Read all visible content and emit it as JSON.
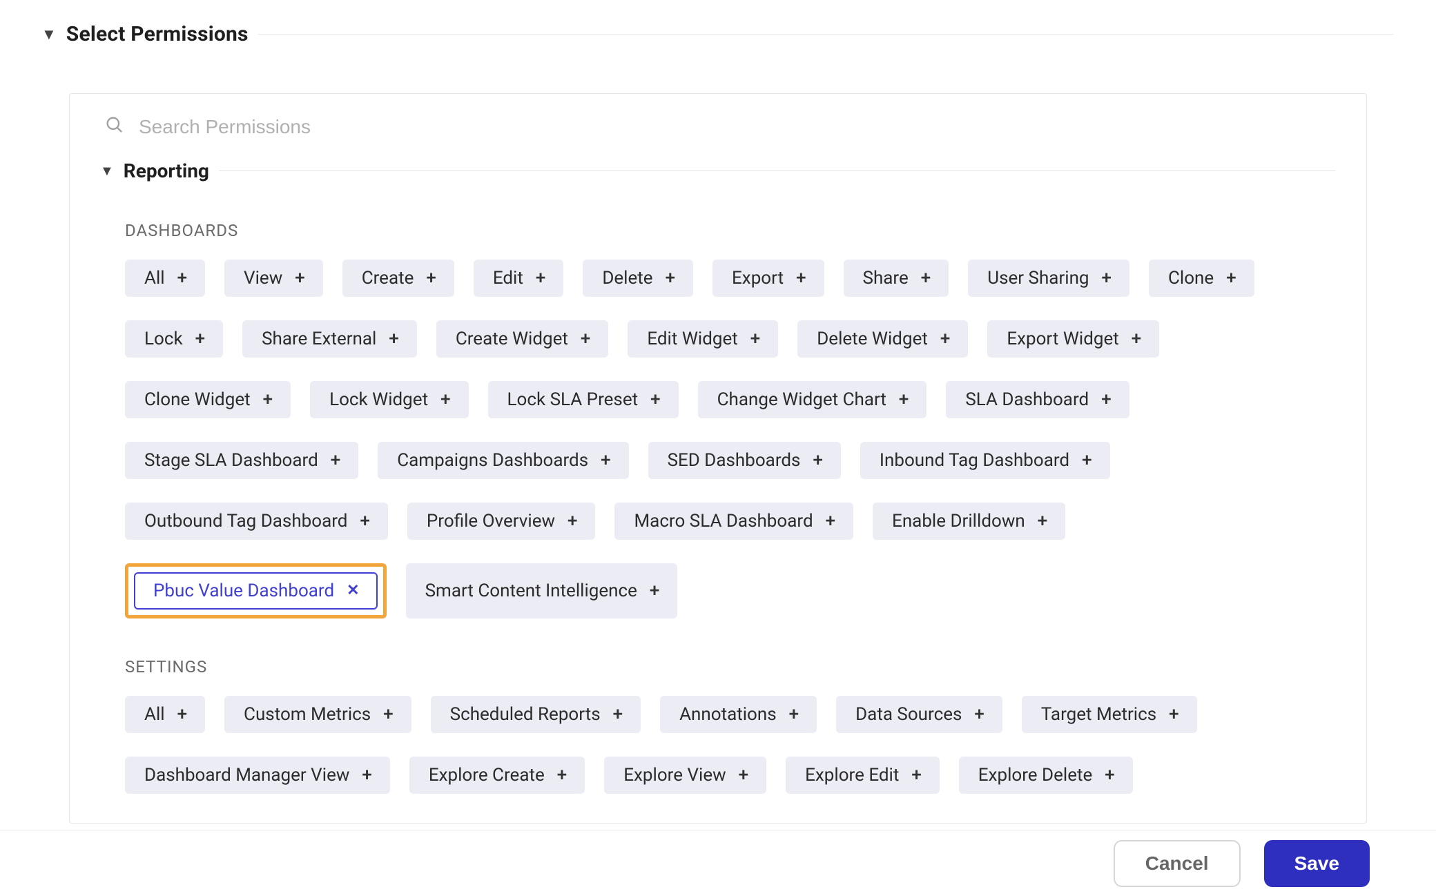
{
  "header": {
    "title": "Select Permissions"
  },
  "search": {
    "placeholder": "Search Permissions"
  },
  "group": {
    "title": "Reporting"
  },
  "subgroups": {
    "dashboards": {
      "label": "DASHBOARDS",
      "items": [
        "All",
        "View",
        "Create",
        "Edit",
        "Delete",
        "Export",
        "Share",
        "User Sharing",
        "Clone",
        "Lock",
        "Share External",
        "Create Widget",
        "Edit Widget",
        "Delete Widget",
        "Export Widget",
        "Clone Widget",
        "Lock Widget",
        "Lock SLA Preset",
        "Change Widget Chart",
        "SLA Dashboard",
        "Stage SLA Dashboard",
        "Campaigns Dashboards",
        "SED Dashboards",
        "Inbound Tag Dashboard",
        "Outbound Tag Dashboard",
        "Profile Overview",
        "Macro SLA Dashboard",
        "Enable Drilldown",
        "Pbuc Value Dashboard",
        "Smart Content Intelligence"
      ],
      "selected": [
        "Pbuc Value Dashboard"
      ],
      "highlighted": [
        "Pbuc Value Dashboard"
      ]
    },
    "settings": {
      "label": "SETTINGS",
      "items": [
        "All",
        "Custom Metrics",
        "Scheduled Reports",
        "Annotations",
        "Data Sources",
        "Target Metrics",
        "Dashboard Manager View",
        "Explore Create",
        "Explore View",
        "Explore Edit",
        "Explore Delete"
      ],
      "selected": [],
      "highlighted": []
    }
  },
  "footer": {
    "cancel": "Cancel",
    "save": "Save"
  }
}
